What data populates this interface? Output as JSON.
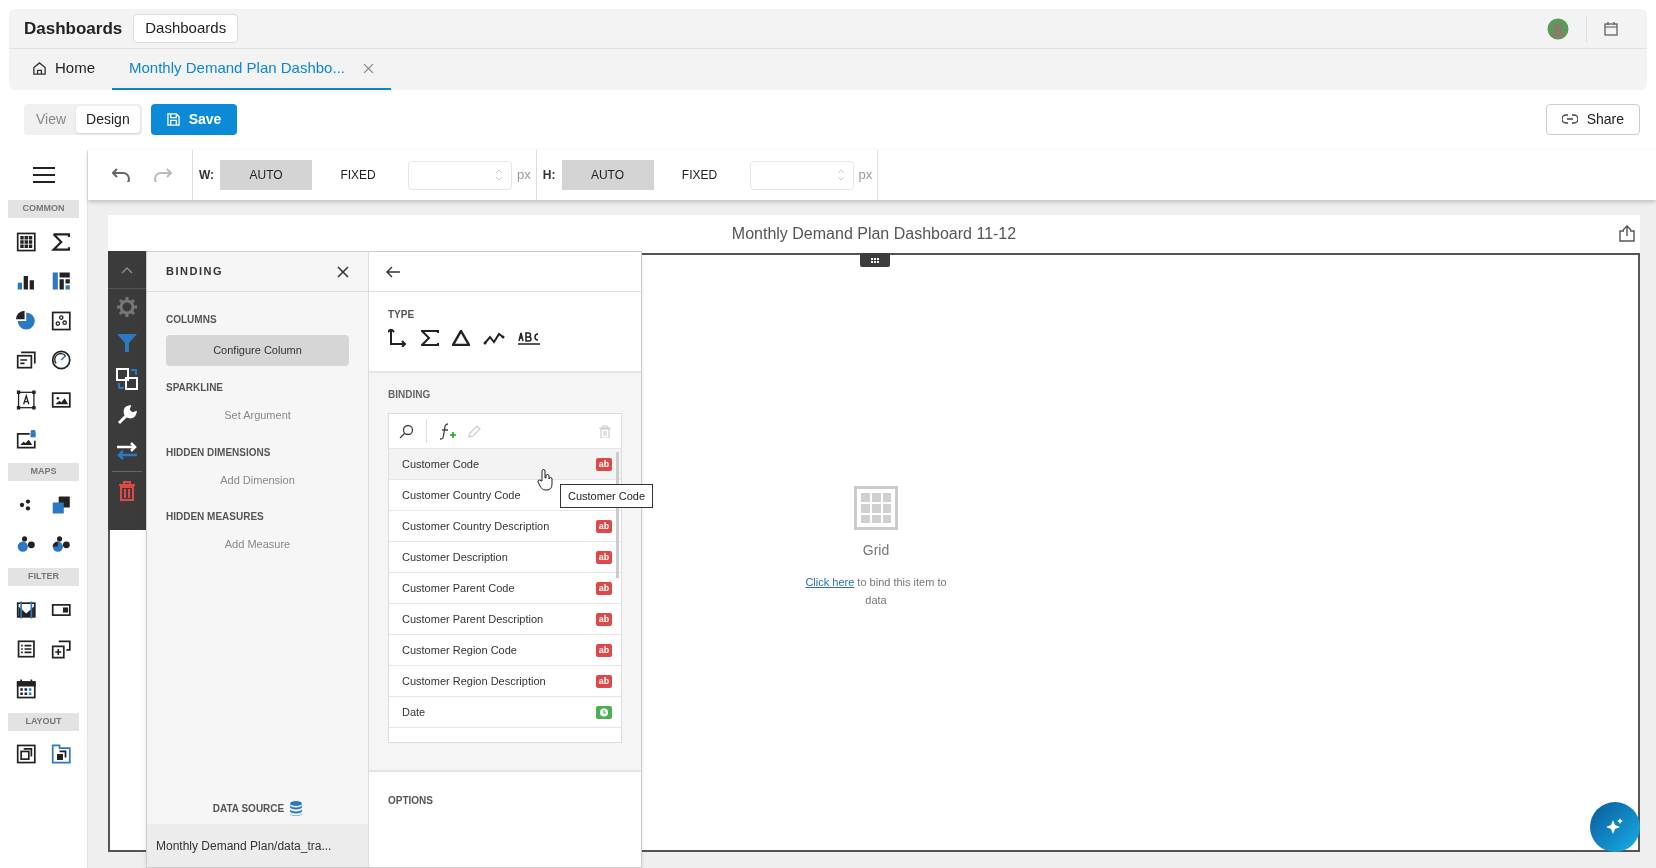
{
  "header": {
    "title": "Dashboards",
    "button": "Dashboards"
  },
  "tabs": [
    {
      "label": "Home",
      "selected": false,
      "kind": "home"
    },
    {
      "label": "Monthly Demand Plan Dashbo...",
      "selected": true,
      "kind": "document"
    }
  ],
  "mode": [
    {
      "label": "View",
      "selected": false
    },
    {
      "label": "Design",
      "selected": true
    }
  ],
  "save_button": "Save",
  "share_button": "Share",
  "size_toolbar": [
    {
      "label": "W:",
      "options": [
        {
          "label": "AUTO",
          "selected": true
        },
        {
          "label": "FIXED",
          "selected": false
        }
      ],
      "unit": "px"
    },
    {
      "label": "H:",
      "options": [
        {
          "label": "AUTO",
          "selected": true
        },
        {
          "label": "FIXED",
          "selected": false
        }
      ],
      "unit": "px"
    }
  ],
  "toolbox_groups": [
    {
      "label": "COMMON"
    },
    {
      "label": "MAPS"
    },
    {
      "label": "FILTER"
    },
    {
      "label": "LAYOUT"
    }
  ],
  "dashboard": {
    "title": "Monthly Demand Plan Dashboard 11-12",
    "item_caption": "Grid",
    "bind_link": "Click here",
    "bind_text": "to bind this item to data"
  },
  "binding_panel": {
    "title": "BINDING",
    "sections": [
      {
        "label": "COLUMNS",
        "action": "Configure Column",
        "kind": "button"
      },
      {
        "label": "SPARKLINE",
        "action": "Set Argument",
        "kind": "link"
      },
      {
        "label": "HIDDEN DIMENSIONS",
        "action": "Add Dimension",
        "kind": "link"
      },
      {
        "label": "HIDDEN MEASURES",
        "action": "Add Measure",
        "kind": "link"
      }
    ],
    "data_source_label": "DATA SOURCE",
    "data_source": "Monthly Demand Plan/data_tra..."
  },
  "field_panel": {
    "type_label": "TYPE",
    "binding_label": "BINDING",
    "options_label": "OPTIONS",
    "fields": [
      {
        "name": "Customer Code",
        "kind": "text",
        "badge": "ab",
        "highlighted": true
      },
      {
        "name": "Customer Country Code",
        "kind": "text",
        "highlighted": false
      },
      {
        "name": "Customer Country Description",
        "kind": "text",
        "badge": "ab",
        "highlighted": false
      },
      {
        "name": "Customer Description",
        "kind": "text",
        "badge": "ab",
        "highlighted": false
      },
      {
        "name": "Customer Parent Code",
        "kind": "text",
        "badge": "ab",
        "highlighted": false
      },
      {
        "name": "Customer Parent Description",
        "kind": "text",
        "badge": "ab",
        "highlighted": false
      },
      {
        "name": "Customer Region Code",
        "kind": "text",
        "badge": "ab",
        "highlighted": false
      },
      {
        "name": "Customer Region Description",
        "kind": "text",
        "badge": "ab",
        "highlighted": false
      },
      {
        "name": "Date",
        "kind": "date",
        "highlighted": false
      }
    ],
    "tooltip": "Customer Code"
  }
}
